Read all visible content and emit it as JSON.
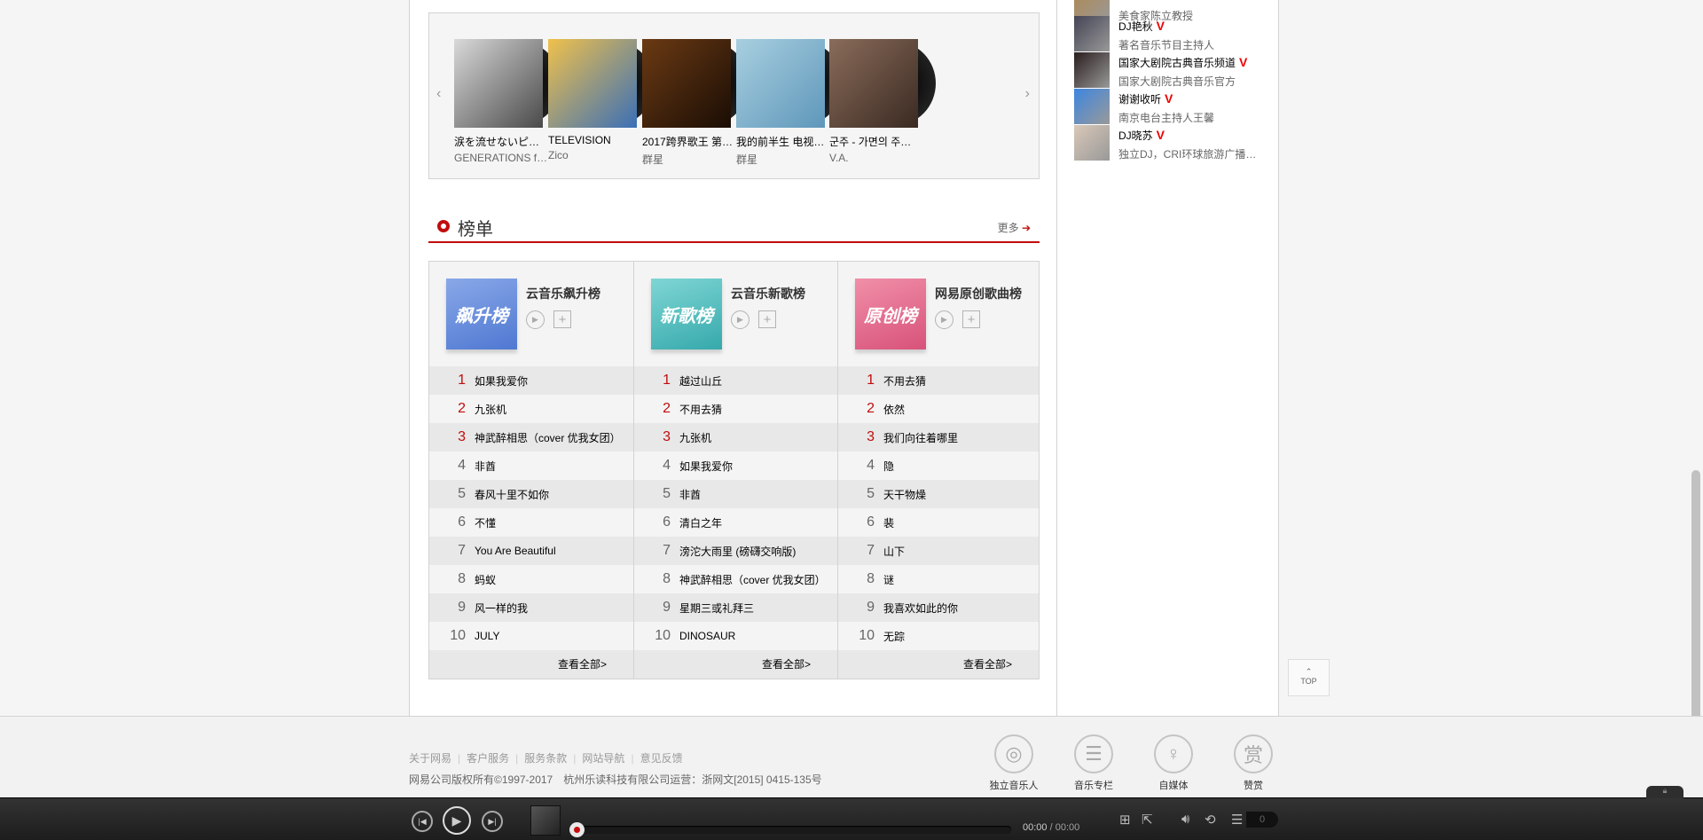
{
  "albums": [
    {
      "name": "涙を流せないピ…",
      "artist": "GENERATIONS f…",
      "c1": "#d9d9d9",
      "c2": "#4a4a4a"
    },
    {
      "name": "TELEVISION",
      "artist": "Zico",
      "c1": "#f0c14b",
      "c2": "#3a6fb7"
    },
    {
      "name": "2017跨界歌王 第…",
      "artist": "群星",
      "c1": "#6b3a13",
      "c2": "#1a0d05"
    },
    {
      "name": "我的前半生 电视…",
      "artist": "群星",
      "c1": "#a8cfe0",
      "c2": "#5f97ba"
    },
    {
      "name": "군주 - 가면의 주…",
      "artist": "V.A.",
      "c1": "#8a6c5a",
      "c2": "#3a2a22"
    }
  ],
  "section": {
    "title": "榜单",
    "more": "更多"
  },
  "charts": [
    {
      "name": "云音乐飙升榜",
      "cover_text": "飙升榜",
      "c1": "#89a8e8",
      "c2": "#4f78d2",
      "tracks": [
        "如果我爱你",
        "九张机",
        "神武醉相思（cover 优我女团）",
        "非酋",
        "春风十里不如你",
        "不懂",
        "You Are Beautiful",
        "蚂蚁",
        "风一样的我",
        "JULY"
      ],
      "view_all": "查看全部>"
    },
    {
      "name": "云音乐新歌榜",
      "cover_text": "新歌榜",
      "c1": "#7fd6d4",
      "c2": "#36a9ac",
      "tracks": [
        "越过山丘",
        "不用去猜",
        "九张机",
        "如果我爱你",
        "非酋",
        "清白之年",
        "滂沱大雨里 (磅礴交响版)",
        "神武醉相思（cover 优我女团）",
        "星期三或礼拜三",
        "DINOSAUR"
      ],
      "view_all": "查看全部>"
    },
    {
      "name": "网易原创歌曲榜",
      "cover_text": "原创榜",
      "c1": "#f08fa8",
      "c2": "#d8527a",
      "tracks": [
        "不用去猜",
        "依然",
        "我们向往着哪里",
        "隐",
        "天干物燥",
        "裴",
        "山下",
        "谜",
        "我喜欢如此的你",
        "无踪"
      ],
      "view_all": "查看全部>"
    }
  ],
  "numbers": [
    "1",
    "2",
    "3",
    "4",
    "5",
    "6",
    "7",
    "8",
    "9",
    "10"
  ],
  "djs": [
    {
      "name": "",
      "desc": "美食家陈立教授",
      "v": false,
      "color": "#b08850"
    },
    {
      "name": "DJ艳秋",
      "desc": "著名音乐节目主持人",
      "v": true,
      "color": "#444455"
    },
    {
      "name": "国家大剧院古典音乐频道",
      "desc": "国家大剧院古典音乐官方",
      "v": true,
      "color": "#2a1e1e"
    },
    {
      "name": "谢谢收听",
      "desc": "南京电台主持人王馨",
      "v": true,
      "color": "#3d86e0"
    },
    {
      "name": "DJ晓苏",
      "desc": "独立DJ，CRI环球旅游广播…",
      "v": true,
      "color": "#d9c8b8"
    }
  ],
  "v_mark": "V",
  "top_button": {
    "arrow": "⌃",
    "label": "TOP"
  },
  "footer": {
    "links": [
      "关于网易",
      "客户服务",
      "服务条款",
      "网站导航",
      "意见反馈"
    ],
    "sep": "|",
    "copyright": "网易公司版权所有©1997-2017　杭州乐读科技有限公司运营：浙网文[2015] 0415-135号",
    "icons": [
      {
        "label": "独立音乐人",
        "glyph": "◎"
      },
      {
        "label": "音乐专栏",
        "glyph": "☰"
      },
      {
        "label": "自媒体",
        "glyph": "♀"
      },
      {
        "label": "赞赏",
        "glyph": "赏"
      }
    ]
  },
  "player": {
    "time_current": "00:00",
    "time_total": "/ 00:00",
    "progress": 0,
    "playlist_count": "0"
  }
}
